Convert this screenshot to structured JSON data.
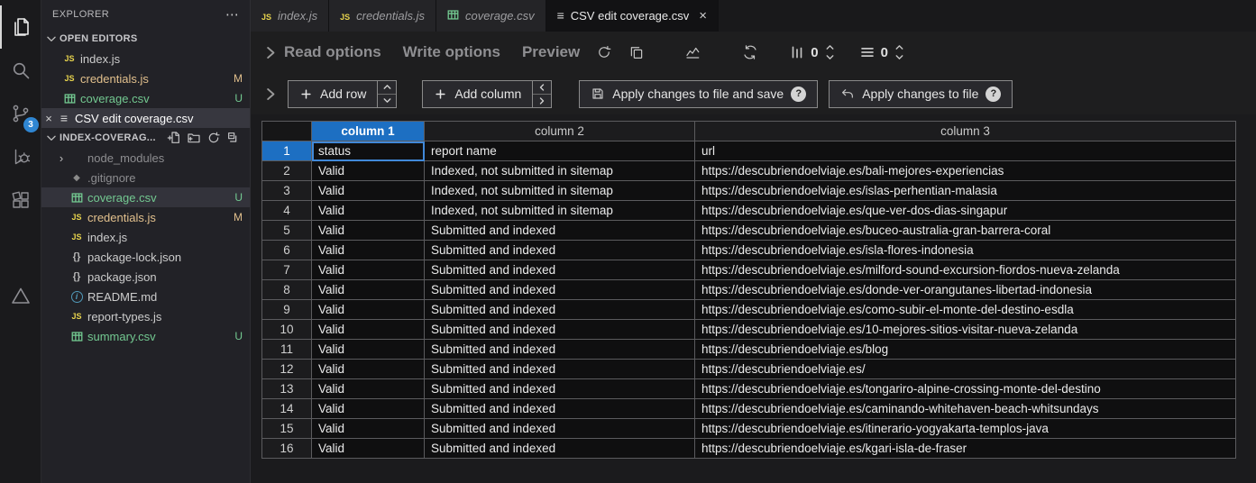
{
  "colors": {
    "accent_blue": "#1d6fc2",
    "scm_badge_blue": "#2f86d2",
    "modified_orange": "#e2c08d",
    "untracked_green": "#73c991",
    "js_yellow": "#e8d44d"
  },
  "icons_glyphs": {
    "more-actions": "⋯",
    "close": "×",
    "csv-editor": "≡",
    "json-braces": "{}",
    "gitignore": "◆"
  },
  "activity_bar": {
    "items": [
      {
        "name": "explorer",
        "icon": "files",
        "active": true
      },
      {
        "name": "search",
        "icon": "search"
      },
      {
        "name": "source-control",
        "icon": "scm",
        "badge": "3"
      },
      {
        "name": "run-debug",
        "icon": "debug"
      },
      {
        "name": "extensions",
        "icon": "extensions"
      },
      {
        "name": "custom-extension",
        "icon": "triangle",
        "gap": true
      }
    ]
  },
  "sidebar": {
    "title": "EXPLORER",
    "open_editors": {
      "label": "OPEN EDITORS",
      "items": [
        {
          "label": "index.js",
          "icon": "js"
        },
        {
          "label": "credentials.js",
          "icon": "js",
          "badge": "M",
          "color": "orange"
        },
        {
          "label": "coverage.csv",
          "icon": "csv",
          "badge": "U",
          "color": "green"
        },
        {
          "label": "CSV edit coverage.csv",
          "icon": "csv-edit",
          "active": true,
          "closable": true
        }
      ]
    },
    "workspace": {
      "label": "INDEX-COVERAG...",
      "items": [
        {
          "label": "node_modules",
          "chevron": true,
          "dim": true
        },
        {
          "label": ".gitignore",
          "icon": "git",
          "dim": true
        },
        {
          "label": "coverage.csv",
          "icon": "csv",
          "badge": "U",
          "color": "green",
          "selected": true
        },
        {
          "label": "credentials.js",
          "icon": "js",
          "badge": "M",
          "color": "orange"
        },
        {
          "label": "index.js",
          "icon": "js"
        },
        {
          "label": "package-lock.json",
          "icon": "braces"
        },
        {
          "label": "package.json",
          "icon": "braces"
        },
        {
          "label": "README.md",
          "icon": "info"
        },
        {
          "label": "report-types.js",
          "icon": "js"
        },
        {
          "label": "summary.csv",
          "icon": "csv",
          "badge": "U",
          "color": "green"
        }
      ]
    }
  },
  "tabs": [
    {
      "label": "index.js",
      "icon": "js",
      "italic": true
    },
    {
      "label": "credentials.js",
      "icon": "js",
      "italic": true
    },
    {
      "label": "coverage.csv",
      "icon": "csv",
      "italic": true
    },
    {
      "label": "CSV edit coverage.csv",
      "icon": "csv-edit",
      "active": true,
      "close": "×"
    }
  ],
  "csv_toolbar": {
    "read_options": "Read options",
    "write_options": "Write options",
    "preview": "Preview",
    "column_count": "0",
    "row_count": "0"
  },
  "csv_actions": {
    "add_row": "Add row",
    "add_column": "Add column",
    "apply_save": "Apply changes to file and save",
    "apply": "Apply changes to file"
  },
  "table": {
    "columns": [
      "column 1",
      "column 2",
      "column 3"
    ],
    "selected_column": 0,
    "selected_cell": {
      "row": 0,
      "col": 0
    },
    "rows": [
      [
        "status",
        "report name",
        "url"
      ],
      [
        "Valid",
        "Indexed, not submitted in sitemap",
        "https://descubriendoelviaje.es/bali-mejores-experiencias"
      ],
      [
        "Valid",
        "Indexed, not submitted in sitemap",
        "https://descubriendoelviaje.es/islas-perhentian-malasia"
      ],
      [
        "Valid",
        "Indexed, not submitted in sitemap",
        "https://descubriendoelviaje.es/que-ver-dos-dias-singapur"
      ],
      [
        "Valid",
        "Submitted and indexed",
        "https://descubriendoelviaje.es/buceo-australia-gran-barrera-coral"
      ],
      [
        "Valid",
        "Submitted and indexed",
        "https://descubriendoelviaje.es/isla-flores-indonesia"
      ],
      [
        "Valid",
        "Submitted and indexed",
        "https://descubriendoelviaje.es/milford-sound-excursion-fiordos-nueva-zelanda"
      ],
      [
        "Valid",
        "Submitted and indexed",
        "https://descubriendoelviaje.es/donde-ver-orangutanes-libertad-indonesia"
      ],
      [
        "Valid",
        "Submitted and indexed",
        "https://descubriendoelviaje.es/como-subir-el-monte-del-destino-esdla"
      ],
      [
        "Valid",
        "Submitted and indexed",
        "https://descubriendoelviaje.es/10-mejores-sitios-visitar-nueva-zelanda"
      ],
      [
        "Valid",
        "Submitted and indexed",
        "https://descubriendoelviaje.es/blog"
      ],
      [
        "Valid",
        "Submitted and indexed",
        "https://descubriendoelviaje.es/"
      ],
      [
        "Valid",
        "Submitted and indexed",
        "https://descubriendoelviaje.es/tongariro-alpine-crossing-monte-del-destino"
      ],
      [
        "Valid",
        "Submitted and indexed",
        "https://descubriendoelviaje.es/caminando-whitehaven-beach-whitsundays"
      ],
      [
        "Valid",
        "Submitted and indexed",
        "https://descubriendoelviaje.es/itinerario-yogyakarta-templos-java"
      ],
      [
        "Valid",
        "Submitted and indexed",
        "https://descubriendoelviaje.es/kgari-isla-de-fraser"
      ]
    ]
  }
}
